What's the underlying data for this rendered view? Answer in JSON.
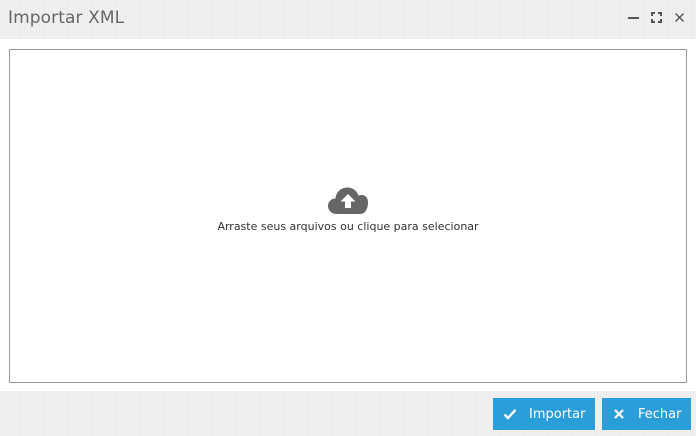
{
  "dialog": {
    "title": "Importar XML",
    "controls": {
      "minimize": "minimize-icon",
      "maximize": "maximize-icon",
      "close": "close-icon"
    }
  },
  "dropzone": {
    "icon": "cloud-upload-icon",
    "text": "Arraste seus arquivos ou clique para selecionar"
  },
  "footer": {
    "import_label": "Importar",
    "import_icon": "check-icon",
    "close_label": "Fechar",
    "close_icon": "times-icon"
  },
  "colors": {
    "primary_button": "#2a9ed9",
    "title_text": "#666666",
    "icon_gray": "#666666"
  }
}
